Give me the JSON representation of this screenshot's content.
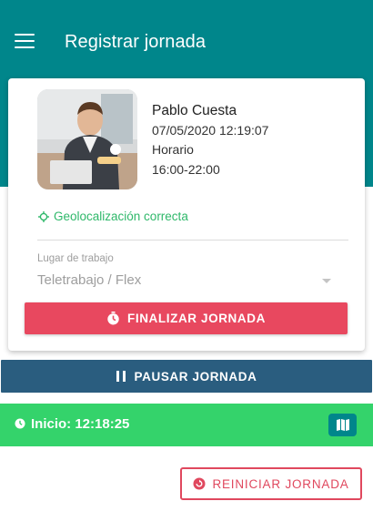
{
  "header": {
    "title": "Registrar jornada",
    "menu_icon": "menu-icon"
  },
  "user": {
    "name": "Pablo Cuesta",
    "datetime": "07/05/2020 12:19:07",
    "schedule_label": "Horario",
    "schedule_hours": "16:00-22:00"
  },
  "geolocation": {
    "text": "Geolocalización correcta",
    "icon": "location-pin-icon"
  },
  "workplace": {
    "label": "Lugar de trabajo",
    "value": "Teletrabajo / Flex"
  },
  "actions": {
    "finalize_label": "FINALIZAR JORNADA",
    "pause_label": "PAUSAR JORNADA",
    "restart_label": "REINICIAR JORNADA"
  },
  "status": {
    "start_text": "Inicio: 12:18:25"
  },
  "colors": {
    "primary_teal": "#00868b",
    "finalize_red": "#e8485f",
    "pause_blue": "#2a5d7f",
    "status_green": "#34d36b",
    "geo_green": "#2fb86a"
  }
}
